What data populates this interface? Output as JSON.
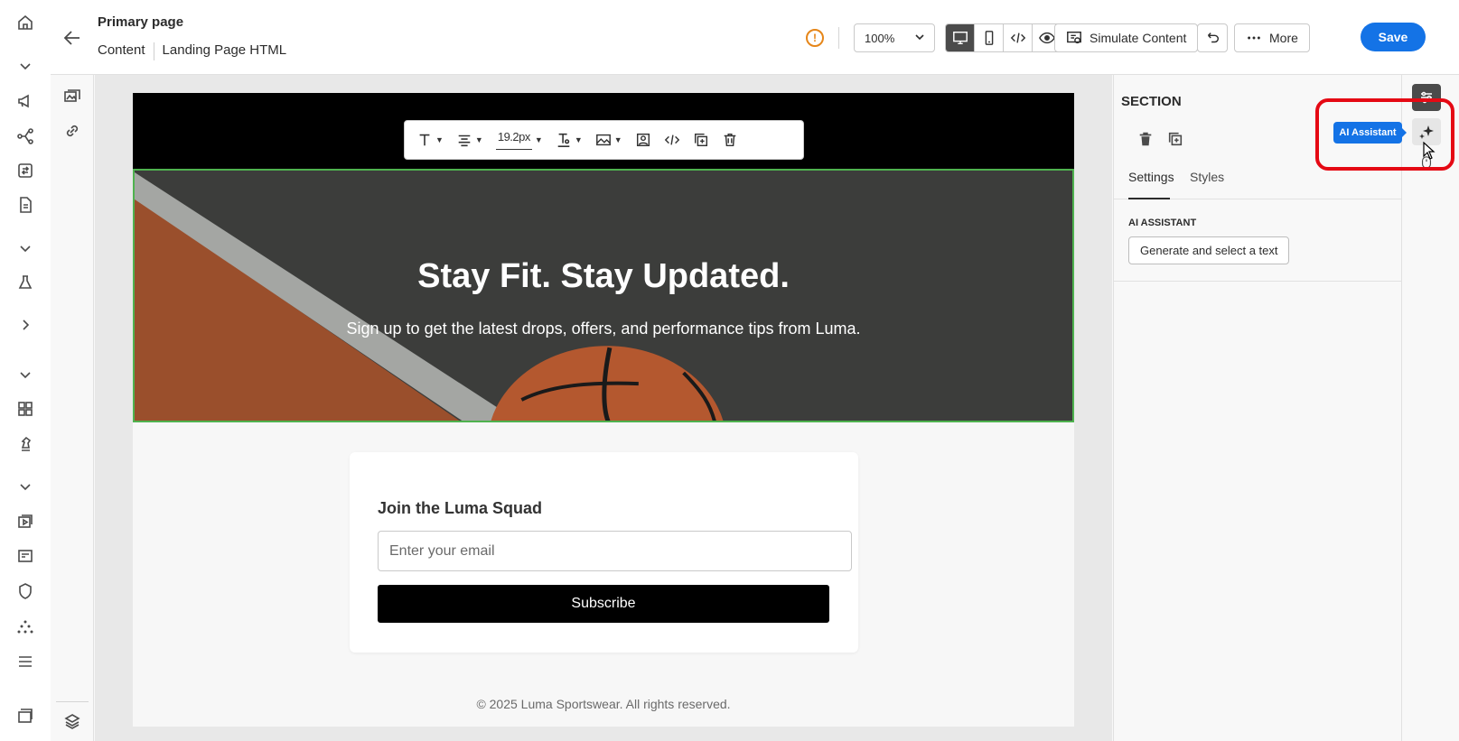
{
  "header": {
    "title": "Primary page",
    "breadcrumbs": [
      "Content",
      "Landing Page HTML"
    ],
    "zoom": "100%",
    "simulate_label": "Simulate Content",
    "more_label": "More",
    "save_label": "Save",
    "warning_glyph": "!"
  },
  "toolbar": {
    "font_size": "19.2px"
  },
  "landing": {
    "hero_title": "Stay Fit. Stay Updated.",
    "hero_subtitle": "Sign up to get the latest drops, offers, and performance tips from Luma.",
    "card_title": "Join the Luma Squad",
    "email_placeholder": "Enter your email",
    "subscribe_label": "Subscribe",
    "footer": "© 2025 Luma Sportswear. All rights reserved."
  },
  "panel": {
    "title": "SECTION",
    "tabs": [
      "Settings",
      "Styles"
    ],
    "active_tab": "Settings",
    "section_label": "AI ASSISTANT",
    "generate_label": "Generate and select a text"
  },
  "right_rail": {
    "tooltip": "AI Assistant"
  },
  "colors": {
    "accent": "#1473e6",
    "highlight": "#e50914",
    "selection": "#4fb24f",
    "warning": "#e68619"
  }
}
